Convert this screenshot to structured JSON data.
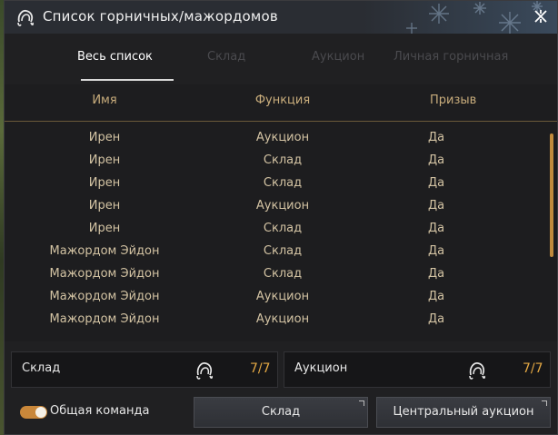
{
  "window": {
    "title": "Список горничных/мажордомов"
  },
  "tabs": [
    {
      "label": "Весь список",
      "active": true
    },
    {
      "label": "Склад",
      "active": false
    },
    {
      "label": "Аукцион",
      "active": false
    },
    {
      "label": "Личная горничная",
      "active": false
    }
  ],
  "table": {
    "columns": [
      "Имя",
      "Функция",
      "Призыв"
    ],
    "rows": [
      [
        "Ирен",
        "Аукцион",
        "Да"
      ],
      [
        "Ирен",
        "Склад",
        "Да"
      ],
      [
        "Ирен",
        "Склад",
        "Да"
      ],
      [
        "Ирен",
        "Аукцион",
        "Да"
      ],
      [
        "Ирен",
        "Склад",
        "Да"
      ],
      [
        "Мажордом Эйдон",
        "Склад",
        "Да"
      ],
      [
        "Мажордом Эйдон",
        "Склад",
        "Да"
      ],
      [
        "Мажордом Эйдон",
        "Аукцион",
        "Да"
      ],
      [
        "Мажордом Эйдон",
        "Аукцион",
        "Да"
      ]
    ]
  },
  "summary": {
    "warehouse": {
      "label": "Склад",
      "count": "7/7"
    },
    "auction": {
      "label": "Аукцион",
      "count": "7/7"
    }
  },
  "footer": {
    "toggle_label": "Общая команда",
    "toggle_on": true,
    "warehouse_button": "Склад",
    "auction_button": "Центральный аукцион"
  },
  "icons": {
    "title": "maid-icon",
    "close": "close-icon",
    "panel": "maid-icon"
  },
  "colors": {
    "accent": "#c9873a",
    "header_text": "#c9ad7c",
    "count": "#e4a843"
  }
}
